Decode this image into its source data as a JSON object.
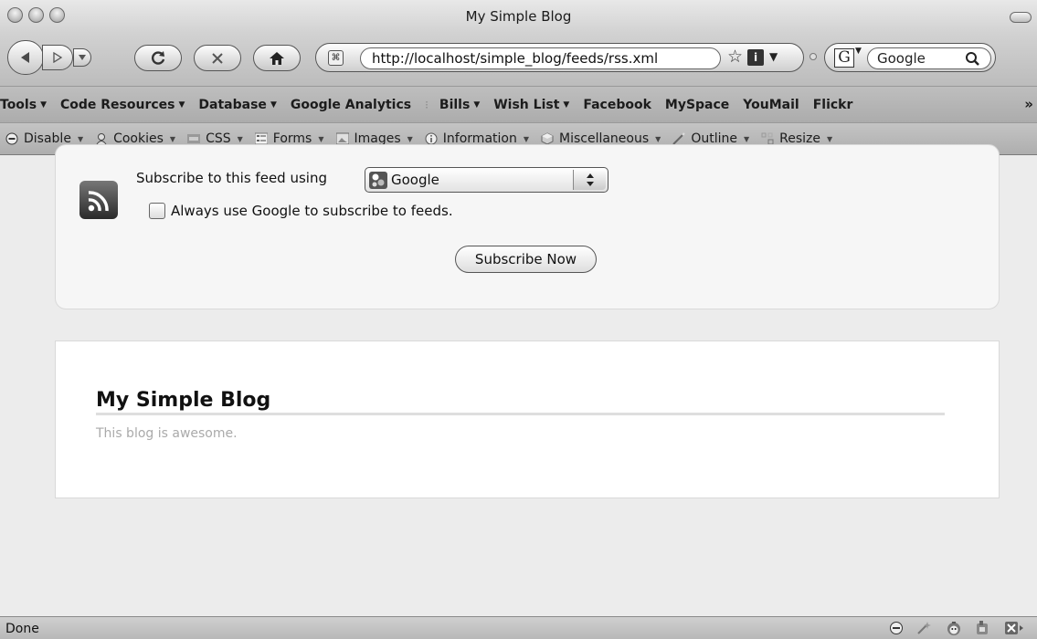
{
  "window": {
    "title": "My Simple Blog"
  },
  "navigation": {
    "url": "http://localhost/simple_blog/feeds/rss.xml",
    "search_engine_letter": "G",
    "search_placeholder": "Google"
  },
  "bookmarks": {
    "items": [
      {
        "label": "Tools",
        "has_menu": true
      },
      {
        "label": "Code Resources",
        "has_menu": true
      },
      {
        "label": "Database",
        "has_menu": true
      },
      {
        "label": "Google Analytics",
        "has_menu": false
      },
      {
        "label": "Bills",
        "has_menu": true
      },
      {
        "label": "Wish List",
        "has_menu": true
      },
      {
        "label": "Facebook",
        "has_menu": false
      },
      {
        "label": "MySpace",
        "has_menu": false
      },
      {
        "label": "YouMail",
        "has_menu": false
      },
      {
        "label": "Flickr",
        "has_menu": false
      }
    ],
    "overflow_label": "»"
  },
  "devbar": {
    "items": [
      {
        "label": "Disable",
        "icon": "disable-icon"
      },
      {
        "label": "Cookies",
        "icon": "cookies-icon"
      },
      {
        "label": "CSS",
        "icon": "css-icon"
      },
      {
        "label": "Forms",
        "icon": "forms-icon"
      },
      {
        "label": "Images",
        "icon": "images-icon"
      },
      {
        "label": "Information",
        "icon": "information-icon"
      },
      {
        "label": "Miscellaneous",
        "icon": "miscellaneous-icon"
      },
      {
        "label": "Outline",
        "icon": "outline-icon"
      },
      {
        "label": "Resize",
        "icon": "resize-icon"
      }
    ]
  },
  "subscribe": {
    "prompt": "Subscribe to this feed using",
    "reader": "Google",
    "always_use_label": "Always use Google to subscribe to feeds.",
    "always_use_checked": false,
    "button_label": "Subscribe Now"
  },
  "blog": {
    "title": "My Simple Blog",
    "description": "This blog is awesome."
  },
  "status": {
    "text": "Done"
  }
}
